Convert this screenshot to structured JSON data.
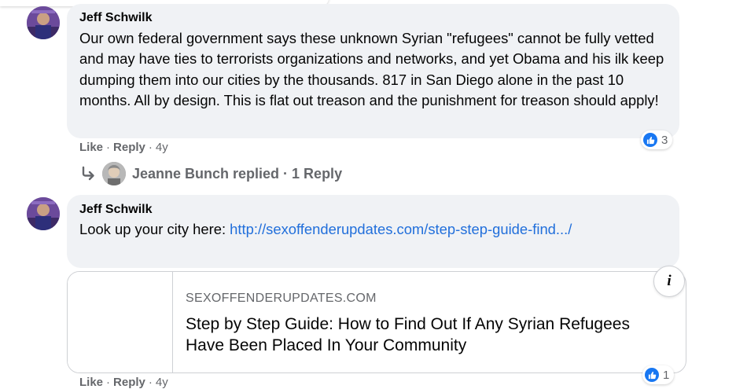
{
  "comments": [
    {
      "author": "Jeff Schwilk",
      "text": "Our own federal government says these unknown Syrian \"refugees\" cannot be fully vetted and may have ties to terrorists organizations and networks, and yet Obama and his ilk keep dumping them into our cities by the thousands. 817 in San Diego alone in the past 10 months. All by design. This is flat out treason and the punishment for treason should apply!",
      "like_label": "Like",
      "reply_label": "Reply",
      "age": "4y",
      "reaction_count": "3"
    },
    {
      "author": "Jeff Schwilk",
      "text_prefix": "Look up your city here: ",
      "link_text": "http://sexoffenderupdates.com/step-step-guide-find.../",
      "like_label": "Like",
      "reply_label": "Reply",
      "age": "4y",
      "reaction_count": "1"
    }
  ],
  "replies_summary": "Jeanne Bunch replied · 1 Reply",
  "link_preview": {
    "domain": "SEXOFFENDERUPDATES.COM",
    "title": "Step by Step Guide: How to Find Out If Any Syrian Refugees Have Been Placed In Your Community",
    "info_glyph": "i"
  },
  "colors": {
    "bubble": "#f0f2f5",
    "link": "#216fdb",
    "muted": "#65676b",
    "like_blue": "#1877f2"
  },
  "icons": [
    "avatar",
    "like-icon",
    "reply-arrow-icon",
    "info-icon"
  ]
}
